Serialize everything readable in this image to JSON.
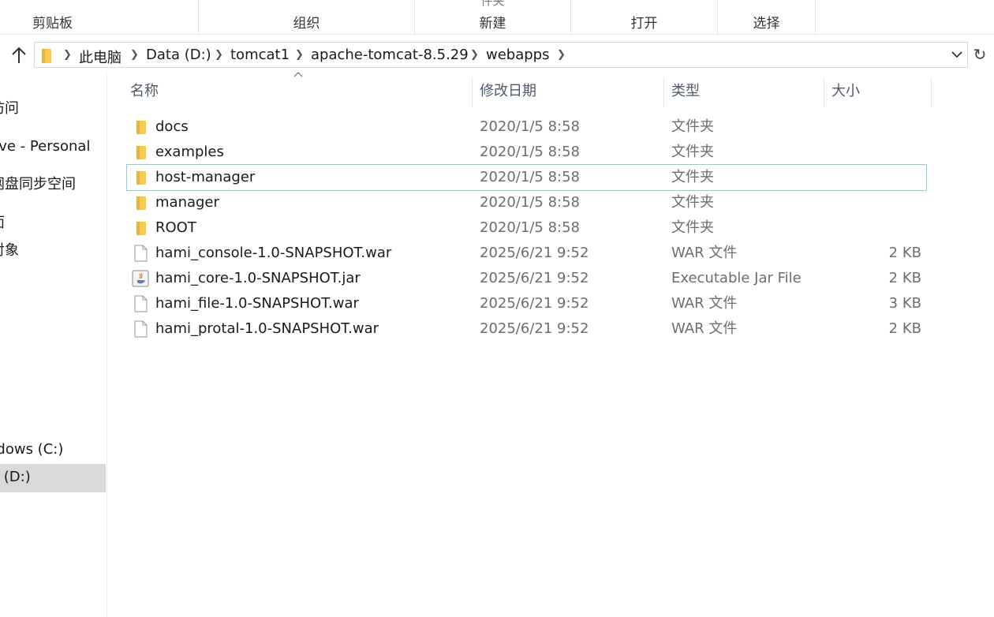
{
  "ribbon": {
    "groups": [
      {
        "label": "剪贴板",
        "peek": ""
      },
      {
        "label": "组织",
        "peek": ""
      },
      {
        "label": "新建",
        "peek": "件夹"
      },
      {
        "label": "打开",
        "peek": ""
      },
      {
        "label": "选择",
        "peek": ""
      }
    ]
  },
  "address": {
    "crumbs": [
      "此电脑",
      "Data (D:)",
      "tomcat1",
      "apache-tomcat-8.5.29",
      "webapps"
    ]
  },
  "navpane": {
    "items": [
      "访问",
      "Drive - Personal",
      "网盘同步空间",
      "面",
      "对象",
      "ndows (C:)",
      "a (D:)"
    ]
  },
  "columns": {
    "name": "名称",
    "date": "修改日期",
    "type": "类型",
    "size": "大小"
  },
  "files": [
    {
      "name": "docs",
      "date": "2020/1/5 8:58",
      "type": "文件夹",
      "size": "",
      "icon": "folder-icon"
    },
    {
      "name": "examples",
      "date": "2020/1/5 8:58",
      "type": "文件夹",
      "size": "",
      "icon": "folder-icon"
    },
    {
      "name": "host-manager",
      "date": "2020/1/5 8:58",
      "type": "文件夹",
      "size": "",
      "icon": "folder-icon"
    },
    {
      "name": "manager",
      "date": "2020/1/5 8:58",
      "type": "文件夹",
      "size": "",
      "icon": "folder-icon"
    },
    {
      "name": "ROOT",
      "date": "2020/1/5 8:58",
      "type": "文件夹",
      "size": "",
      "icon": "folder-icon"
    },
    {
      "name": "hami_console-1.0-SNAPSHOT.war",
      "date": "2025/6/21 9:52",
      "type": "WAR 文件",
      "size": "2 KB",
      "icon": "file-icon"
    },
    {
      "name": "hami_core-1.0-SNAPSHOT.jar",
      "date": "2025/6/21 9:52",
      "type": "Executable Jar File",
      "size": "2 KB",
      "icon": "java-jar-icon"
    },
    {
      "name": "hami_file-1.0-SNAPSHOT.war",
      "date": "2025/6/21 9:52",
      "type": "WAR 文件",
      "size": "3 KB",
      "icon": "file-icon"
    },
    {
      "name": "hami_protal-1.0-SNAPSHOT.war",
      "date": "2025/6/21 9:52",
      "type": "WAR 文件",
      "size": "2 KB",
      "icon": "file-icon"
    }
  ],
  "colors": {
    "folder": "#f8c94c",
    "selected_nav": "#d9d9d9",
    "focus_outline": "#8fd0d8"
  }
}
